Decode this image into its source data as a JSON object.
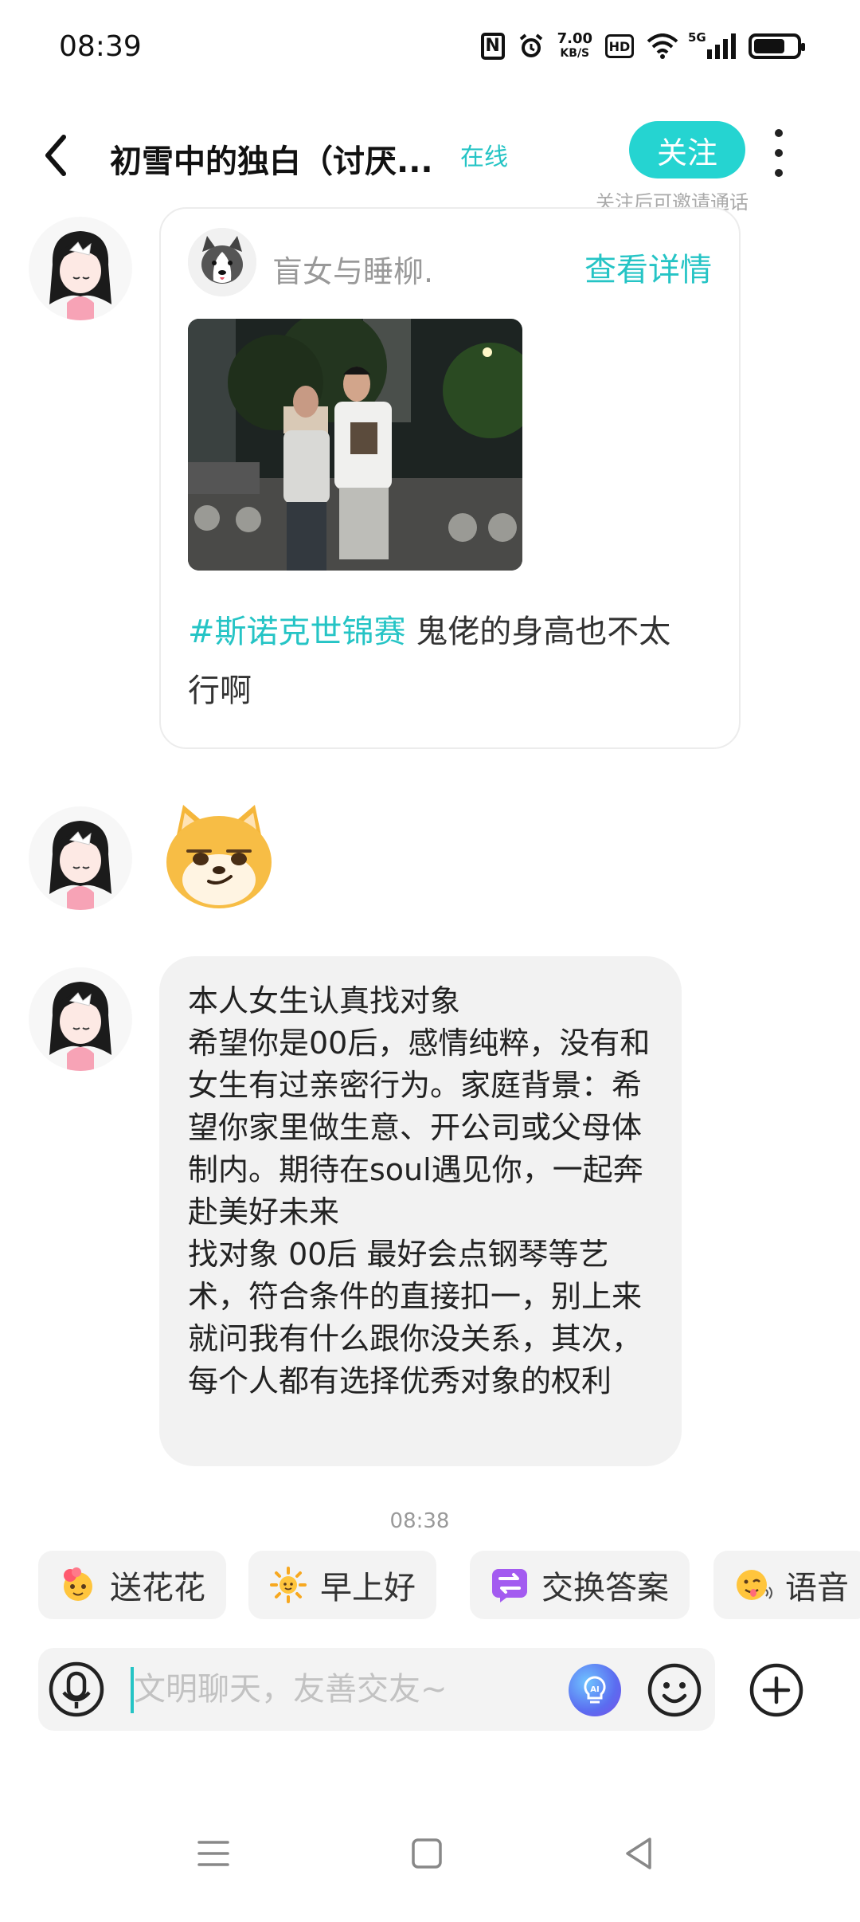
{
  "status_bar": {
    "time": "08:39",
    "nfc": "N",
    "speed_value": "7.00",
    "speed_unit": "KB/S",
    "hd": "HD",
    "network": "5G",
    "battery_level": 0.65
  },
  "header": {
    "title": "初雪中的独白（讨厌...",
    "status": "在线",
    "follow_button": "关注",
    "follow_hint": "关注后可邀请通话"
  },
  "messages": {
    "post": {
      "user_name": "盲女与睡柳.",
      "detail_link": "查看详情",
      "hashtag": "#斯诺克世锦赛",
      "text": " 鬼佬的身高也不太行啊"
    },
    "text_bubble": "本人女生认真找对象\n希望你是00后，感情纯粹，没有和女生有过亲密行为。家庭背景：希望你家里做生意、开公司或父母体制内。期待在soul遇见你，一起奔赴美好未来\n找对象 00后 最好会点钢琴等艺术，符合条件的直接扣一，别上来就问我有什么跟你没关系，其次，每个人都有选择优秀对象的权利",
    "timestamp": "08:38"
  },
  "quick_replies": [
    {
      "label": "送花花",
      "icon": "flower-face-icon"
    },
    {
      "label": "早上好",
      "icon": "sun-icon"
    },
    {
      "label": "交换答案",
      "icon": "exchange-icon"
    },
    {
      "label": "语音",
      "icon": "tongue-face-icon"
    }
  ],
  "input": {
    "placeholder": "文明聊天，友善交友~"
  },
  "colors": {
    "accent": "#25c4c5",
    "follow_button": "#25d4d1",
    "bubble": "#f2f2f2"
  }
}
